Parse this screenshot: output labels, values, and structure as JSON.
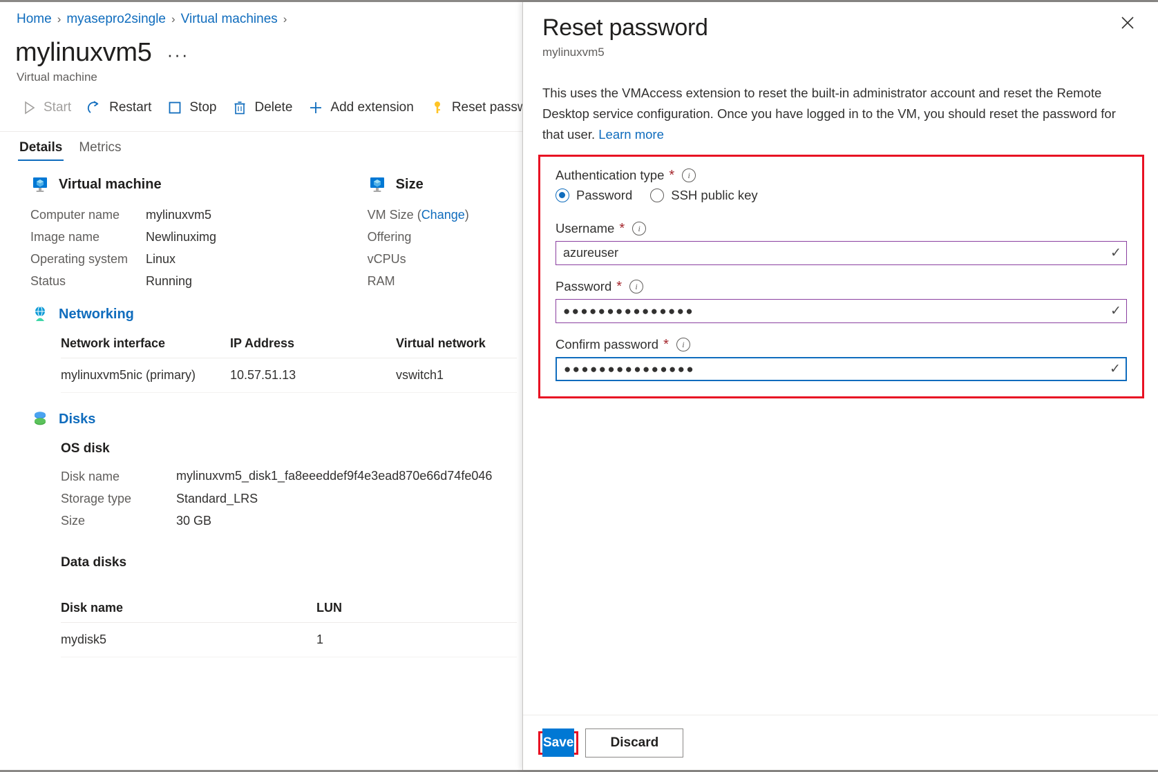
{
  "breadcrumb": {
    "items": [
      "Home",
      "myasepro2single",
      "Virtual machines"
    ],
    "separator": "›"
  },
  "header": {
    "title": "mylinuxvm5",
    "ellipsis": "···",
    "subtitle": "Virtual machine"
  },
  "toolbar": {
    "items": [
      {
        "label": "Start",
        "icon": "play-icon",
        "disabled": true
      },
      {
        "label": "Restart",
        "icon": "restart-icon",
        "disabled": false
      },
      {
        "label": "Stop",
        "icon": "stop-icon",
        "disabled": false
      },
      {
        "label": "Delete",
        "icon": "trash-icon",
        "disabled": false
      },
      {
        "label": "Add extension",
        "icon": "plus-icon",
        "disabled": false
      },
      {
        "label": "Reset password",
        "icon": "key-icon",
        "disabled": false
      }
    ]
  },
  "tabs": [
    {
      "label": "Details",
      "active": true
    },
    {
      "label": "Metrics",
      "active": false
    }
  ],
  "details": {
    "virtual_machine": {
      "heading": "Virtual machine",
      "rows": [
        {
          "key": "Computer name",
          "value": "mylinuxvm5"
        },
        {
          "key": "Image name",
          "value": "Newlinuximg"
        },
        {
          "key": "Operating system",
          "value": "Linux"
        },
        {
          "key": "Status",
          "value": "Running"
        }
      ]
    },
    "size": {
      "heading": "Size",
      "rows": [
        {
          "key": "VM Size (",
          "link": "Change",
          "key_end": ")",
          "value": ""
        },
        {
          "key": "Offering",
          "value": ""
        },
        {
          "key": "vCPUs",
          "value": ""
        },
        {
          "key": "RAM",
          "value": ""
        }
      ]
    },
    "networking": {
      "heading": "Networking",
      "columns": [
        "Network interface",
        "IP Address",
        "Virtual network"
      ],
      "rows": [
        [
          "mylinuxvm5nic (primary)",
          "10.57.51.13",
          "vswitch1"
        ]
      ]
    },
    "disks": {
      "heading": "Disks",
      "os_disk": {
        "heading": "OS disk",
        "rows": [
          {
            "key": "Disk name",
            "value": "mylinuxvm5_disk1_fa8eeeddef9f4e3ead870e66d74fe046"
          },
          {
            "key": "Storage type",
            "value": "Standard_LRS"
          },
          {
            "key": "Size",
            "value": "30 GB"
          }
        ]
      },
      "data_disks": {
        "heading": "Data disks",
        "columns": [
          "Disk name",
          "LUN"
        ],
        "rows": [
          [
            "mydisk5",
            "1"
          ]
        ]
      }
    }
  },
  "panel": {
    "title": "Reset password",
    "subtitle": "mylinuxvm5",
    "close_glyph": "✕",
    "description": "This uses the VMAccess extension to reset the built-in administrator account and reset the Remote Desktop service configuration. Once you have logged in to the VM, you should reset the password for that user. ",
    "learn_more": "Learn more",
    "form": {
      "auth_type": {
        "label": "Authentication type",
        "required_glyph": "*",
        "info_glyph": "i",
        "options": [
          {
            "label": "Password",
            "selected": true
          },
          {
            "label": "SSH public key",
            "selected": false
          }
        ]
      },
      "username": {
        "label": "Username",
        "required_glyph": "*",
        "info_glyph": "i",
        "value": "azureuser",
        "placeholder": "",
        "valid_glyph": "✓"
      },
      "password": {
        "label": "Password",
        "required_glyph": "*",
        "info_glyph": "i",
        "value": "●●●●●●●●●●●●●●●",
        "valid_glyph": "✓"
      },
      "confirm_password": {
        "label": "Confirm password",
        "required_glyph": "*",
        "info_glyph": "i",
        "value": "●●●●●●●●●●●●●●●",
        "valid_glyph": "✓"
      }
    },
    "footer": {
      "save_label": "Save",
      "discard_label": "Discard"
    }
  },
  "colors": {
    "link": "#0f6cbd",
    "accent": "#0078d4",
    "highlight_box": "#e81123",
    "input_border": "#8a3fa0",
    "input_border_focused": "#0f6cbd",
    "required": "#a4262c"
  }
}
